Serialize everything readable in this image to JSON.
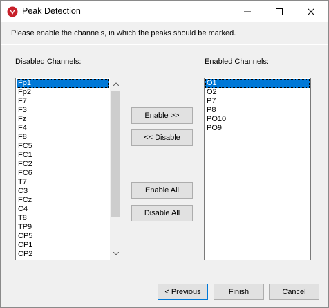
{
  "window": {
    "title": "Peak Detection"
  },
  "instruction": "Please enable the channels, in which the peaks should be marked.",
  "disabled": {
    "label": "Disabled Channels:",
    "items": [
      "Fp1",
      "Fp2",
      "F7",
      "F3",
      "Fz",
      "F4",
      "F8",
      "FC5",
      "FC1",
      "FC2",
      "FC6",
      "T7",
      "C3",
      "FCz",
      "C4",
      "T8",
      "TP9",
      "CP5",
      "CP1",
      "CP2"
    ],
    "selected_index": 0
  },
  "enabled": {
    "label": "Enabled Channels:",
    "items": [
      "O1",
      "O2",
      "P7",
      "P8",
      "PO10",
      "PO9"
    ],
    "selected_index": 0
  },
  "buttons": {
    "enable": "Enable >>",
    "disable": "<< Disable",
    "enable_all": "Enable All",
    "disable_all": "Disable All",
    "previous": "< Previous",
    "finish": "Finish",
    "cancel": "Cancel"
  },
  "colors": {
    "selection": "#0078d7",
    "dialog_bg": "#f0f0f0",
    "focus_border": "#0078d7"
  }
}
